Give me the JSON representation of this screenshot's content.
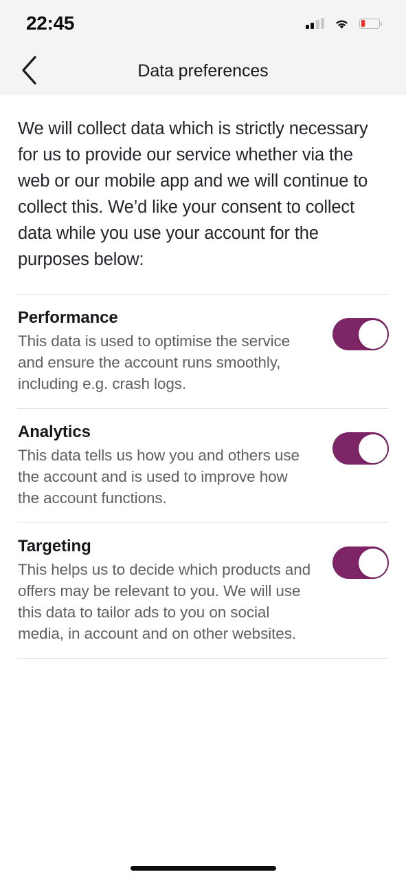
{
  "status_bar": {
    "time": "22:45",
    "signal_icon": "cellular-signal-icon",
    "signal_bars_total": 4,
    "signal_bars_active": 2,
    "wifi_icon": "wifi-icon",
    "battery_icon": "battery-low-icon",
    "battery_percent": 20,
    "battery_color": "#e8342a"
  },
  "nav": {
    "back_icon": "chevron-left-icon",
    "title": "Data preferences"
  },
  "main": {
    "intro": "We will collect data which is strictly necessary for us to provide our service whether via the web or our mobile app and we will continue to collect this. We’d like your consent to collect data while you use your account for the purposes below:",
    "accent_color": "#7e2567",
    "preferences": [
      {
        "title": "Performance",
        "description": "This data is used to optimise the service and ensure the account runs smoothly, including e.g. crash logs.",
        "toggle_state": "on",
        "toggle_name": "toggle-performance"
      },
      {
        "title": "Analytics",
        "description": "This data tells us how you and others use the account and is used to improve how the account functions.",
        "toggle_state": "on",
        "toggle_name": "toggle-analytics"
      },
      {
        "title": "Targeting",
        "description": "This helps us to decide which products and offers may be relevant to you. We will use this data to tailor ads to you on social media, in account and on other websites.",
        "toggle_state": "on",
        "toggle_name": "toggle-targeting"
      }
    ]
  },
  "system": {
    "home_indicator": "home-indicator"
  }
}
